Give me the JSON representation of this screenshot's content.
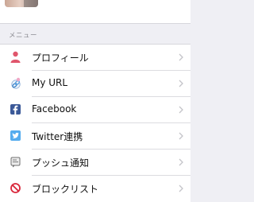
{
  "section": {
    "header": "メニュー"
  },
  "menu": {
    "items": [
      {
        "label": "プロフィール",
        "icon": "person-icon",
        "color": "#e0566c"
      },
      {
        "label": "My URL",
        "icon": "link-icon",
        "color": "#3b82c8"
      },
      {
        "label": "Facebook",
        "icon": "facebook-icon",
        "color": "#3b5998"
      },
      {
        "label": "Twitter連携",
        "icon": "twitter-icon",
        "color": "#55acee"
      },
      {
        "label": "プッシュ通知",
        "icon": "push-notification-icon",
        "color": "#6f6f6f"
      },
      {
        "label": "ブロックリスト",
        "icon": "block-icon",
        "color": "#d9263a"
      }
    ]
  }
}
